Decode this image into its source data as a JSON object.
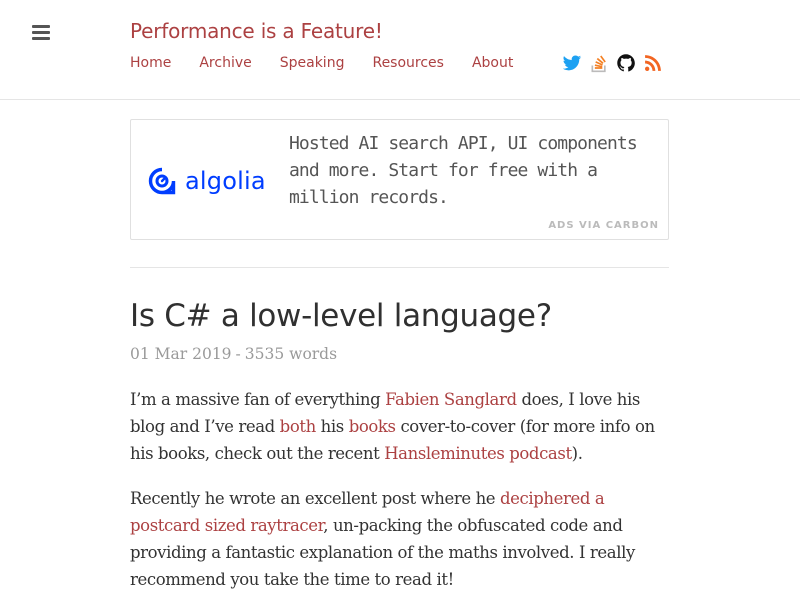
{
  "site": {
    "title": "Performance is a Feature!"
  },
  "nav": [
    "Home",
    "Archive",
    "Speaking",
    "Resources",
    "About"
  ],
  "social_icons": [
    "twitter-icon",
    "stackoverflow-icon",
    "github-icon",
    "rss-icon"
  ],
  "colors": {
    "accent": "#ac4142",
    "algolia_blue": "#003dff",
    "twitter": "#1da1f2",
    "stackoverflow": "#f48024",
    "rss": "#f26522"
  },
  "ad": {
    "brand": "algolia",
    "text": "Hosted AI search API, UI components and more. Start for free with a million records.",
    "via": "ADS VIA CARBON"
  },
  "post": {
    "title": "Is C# a low-level language?",
    "date": "01 Mar 2019",
    "separator": "-",
    "words": "3535 words",
    "p1": {
      "t1": "I’m a massive fan of everything ",
      "link1": "Fabien Sanglard",
      "t2": " does, I love his blog and I’ve read ",
      "link2": "both",
      "t3": " his ",
      "link3": "books",
      "t4": " cover-to-cover (for more info on his books, check out the recent ",
      "link4": "Hansleminutes podcast",
      "t5": ")."
    },
    "p2": {
      "t1": "Recently he wrote an excellent post where he ",
      "link1": "deciphered a postcard sized raytracer",
      "t2": ", un-packing the obfuscated code and providing a fantastic explanation of the maths involved. I really recommend you take the time to read it!"
    }
  }
}
